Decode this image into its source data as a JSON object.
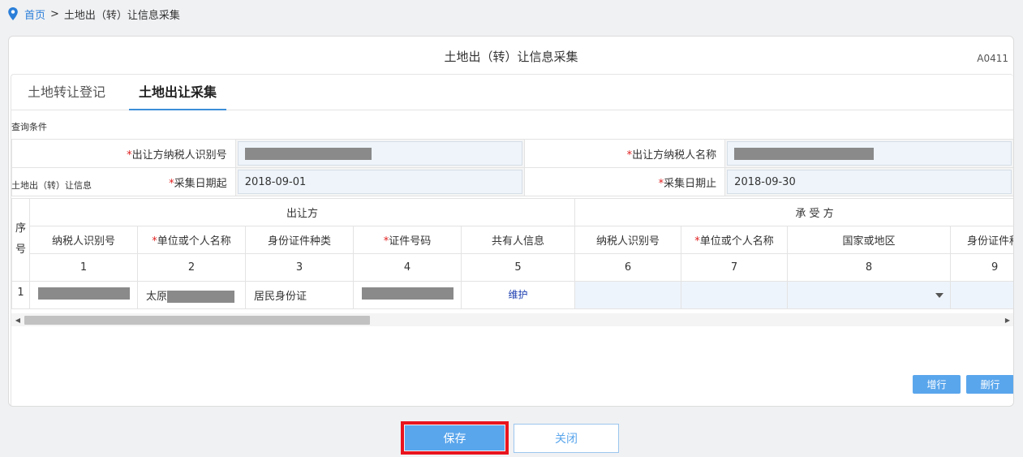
{
  "breadcrumb": {
    "home": "首页",
    "separator": ">",
    "current": "土地出（转）让信息采集",
    "icon": "location-pin-icon"
  },
  "panel": {
    "title": "土地出（转）让信息采集",
    "form_code": "A0411"
  },
  "tabs": [
    {
      "label": "土地转让登记",
      "active": false
    },
    {
      "label": "土地出让采集",
      "active": true
    }
  ],
  "query": {
    "caption": "查询条件",
    "required_mark": "*",
    "seller_tax_id_label": "出让方纳税人识别号",
    "seller_name_label": "出让方纳税人名称",
    "date_start_label": "采集日期起",
    "date_end_label": "采集日期止",
    "date_start_value": "2018-09-01",
    "date_end_value": "2018-09-30"
  },
  "grid": {
    "caption": "土地出（转）让信息",
    "seq_header": "序号",
    "group_seller": "出让方",
    "group_buyer": "承 受 方",
    "required_mark": "*",
    "columns": [
      {
        "label": "纳税人识别号",
        "required": false,
        "num": "1"
      },
      {
        "label": "单位或个人名称",
        "required": true,
        "num": "2"
      },
      {
        "label": "身份证件种类",
        "required": false,
        "num": "3"
      },
      {
        "label": "证件号码",
        "required": true,
        "num": "4"
      },
      {
        "label": "共有人信息",
        "required": false,
        "num": "5"
      },
      {
        "label": "纳税人识别号",
        "required": false,
        "num": "6"
      },
      {
        "label": "单位或个人名称",
        "required": true,
        "num": "7"
      },
      {
        "label": "国家或地区",
        "required": false,
        "num": "8"
      },
      {
        "label": "身份证件种",
        "required": false,
        "num": "9"
      }
    ],
    "rows": [
      {
        "seq": "1",
        "name_prefix": "太原",
        "id_type": "居民身份证",
        "co_owner_link": "维护"
      }
    ]
  },
  "buttons": {
    "add_row": "增行",
    "delete_row": "删行",
    "save": "保存",
    "close": "关闭"
  },
  "colors": {
    "accent": "#5aa6ec",
    "link": "#2b7fd9",
    "required": "#e02020",
    "highlight": "#e8141e"
  }
}
